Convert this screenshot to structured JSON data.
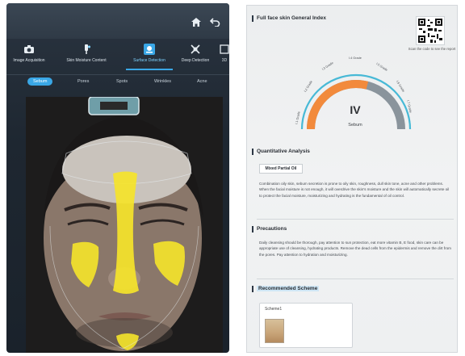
{
  "left": {
    "modes": [
      {
        "label": "Image Acquisition",
        "icon": "camera-icon"
      },
      {
        "label": "Skin Moisture Content",
        "icon": "moisture-probe-icon"
      },
      {
        "label": "Surface Detection",
        "icon": "surface-scan-icon"
      },
      {
        "label": "Deep Detection",
        "icon": "deep-scan-icon"
      },
      {
        "label": "3D",
        "icon": "3d-icon"
      }
    ],
    "active_mode": "Surface Detection",
    "subtabs": [
      "Sebum",
      "Pores",
      "Spots",
      "Wrinkles",
      "Acne"
    ],
    "active_subtab": "Sebum",
    "top_icons": [
      "home-icon",
      "back-icon"
    ],
    "accent": "#3aa7e6",
    "highlight": "#f5e42a"
  },
  "report": {
    "general_index_title": "Full face skin General Index",
    "qr_caption": "Scan the code to see the report",
    "gauge": {
      "grade": "IV",
      "name": "Sebum",
      "level_labels": [
        "I.2 Grade",
        "I.3 Grade",
        "I.4 Grade",
        "I.5 Grade",
        "I.6 Grade",
        "I.7 Grade",
        "I.1 Grade"
      ],
      "fill_fraction": 0.58,
      "colors": {
        "filled": "#f28a3c",
        "empty": "#8a949c",
        "outer_ring": "#47b9d6"
      }
    },
    "quantitative": {
      "title": "Quantitative Analysis",
      "badge": "Mixed Partial Oil",
      "text": "Combination oily skin, sebum secretion is prone to oily skin, roughness, dull skin tone, acne and other problems. When the facial moisture is not enough, it will overdrive the skin's moisture and the skin will automatically secrete oil to protect the facial moisture, moisturizing and hydrating is the fundamental of oil control."
    },
    "precautions": {
      "title": "Precautions",
      "text": "Daily cleansing should be thorough, pay attention to sun protection, eat more vitamin B, E food, skin care can be appropriate use of cleansing, hydrating products. Remove the dead cells from the epidermis and remove the dirt from the pores. Pay attention to hydration and moisturizing."
    },
    "scheme": {
      "title": "Recommended Scheme",
      "card_title": "Scheme1"
    }
  }
}
